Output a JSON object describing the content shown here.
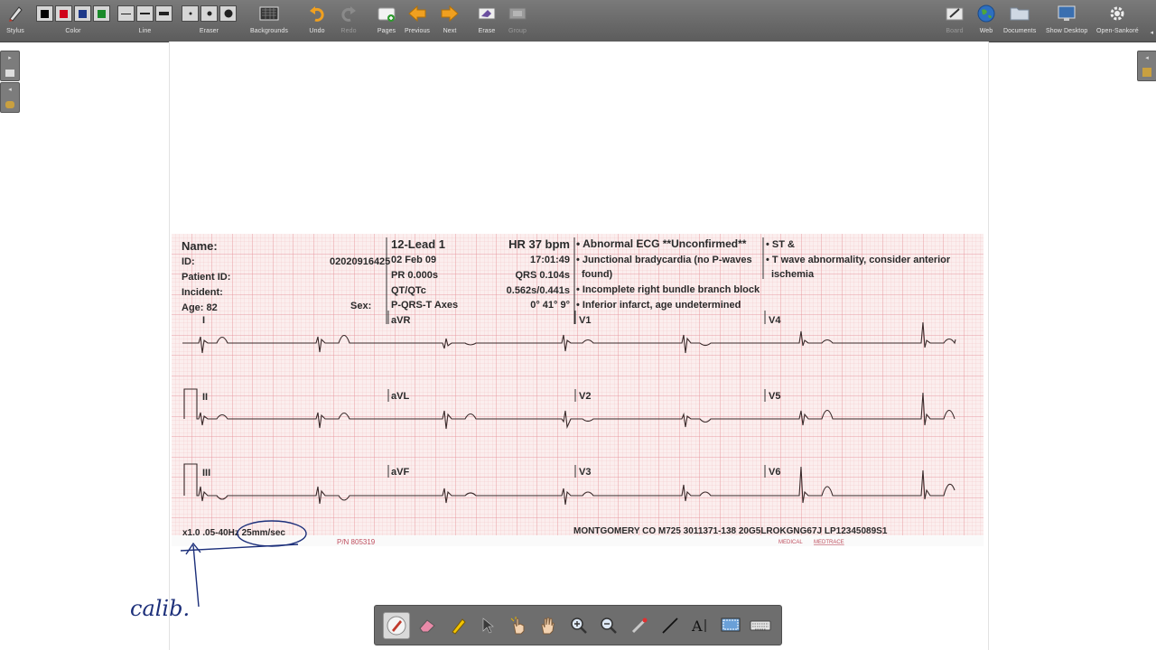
{
  "toolbar": {
    "stylus": "Stylus",
    "color": "Color",
    "line": "Line",
    "eraser": "Eraser",
    "backgrounds": "Backgrounds",
    "undo": "Undo",
    "redo": "Redo",
    "pages": "Pages",
    "previous": "Previous",
    "next": "Next",
    "erase": "Erase",
    "group": "Group",
    "board": "Board",
    "web": "Web",
    "documents": "Documents",
    "show_desktop": "Show Desktop",
    "open_sankore": "Open-Sankoré",
    "colors": [
      "#000000",
      "#d0021b",
      "#1f3a8a",
      "#1a8a2a"
    ]
  },
  "ecg": {
    "name_label": "Name:",
    "id_label": "ID:",
    "id_value": "02020916425",
    "patient_id_label": "Patient ID:",
    "incident_label": "Incident:",
    "age_label": "Age: 82",
    "sex_label": "Sex:",
    "lead_title": "12-Lead 1",
    "date": "02 Feb 09",
    "pr": "PR 0.000s",
    "qtqtc_label": "QT/QTc",
    "axes_label": "P-QRS-T Axes",
    "hr": "HR 37 bpm",
    "time": "17:01:49",
    "qrs": "QRS 0.104s",
    "qtqtc_value": "0.562s/0.441s",
    "axes_value": "0° 41° 9°",
    "interp_title": "• Abnormal ECG **Unconfirmed**",
    "interp_1": "• Junctional bradycardia (no P-waves",
    "interp_1b": "found)",
    "interp_2": "• Incomplete right bundle branch block",
    "interp_3": "• Inferior infarct, age undetermined",
    "interp_4": "• ST &",
    "interp_5": "• T wave abnormality, consider anterior",
    "interp_5b": "ischemia",
    "leads": [
      "I",
      "aVR",
      "V1",
      "V4",
      "II",
      "aVL",
      "V2",
      "V5",
      "III",
      "aVF",
      "V3",
      "V6"
    ],
    "footer_left": "x1.0 .05-40Hz 25mm/sec",
    "footer_right": "MONTGOMERY CO M725 3011371-138 20G5LROKGNG67J LP12345089S1",
    "part_number": "P/N 805319",
    "medical_brand": "MEDICAL",
    "medtrace": "MEDTRACE"
  },
  "annotation": {
    "handwriting": "calib."
  }
}
